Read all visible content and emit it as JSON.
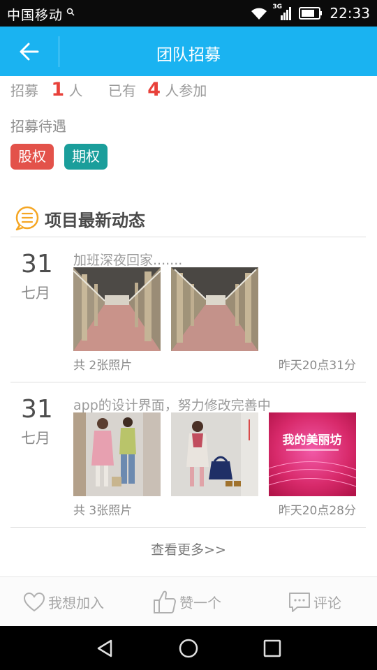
{
  "status_bar": {
    "carrier": "中国移动",
    "network": "3G",
    "time": "22:33"
  },
  "header": {
    "title": "团队招募",
    "back_icon": "arrow-left-icon"
  },
  "recruit": {
    "prefix": "招募",
    "count": "1",
    "unit": "人",
    "joined_prefix": "已有",
    "joined_count": "4",
    "joined_suffix": "人参加",
    "benefits_label": "招募待遇",
    "tags": [
      {
        "label": "股权",
        "color": "#e3524a"
      },
      {
        "label": "期权",
        "color": "#1a9e9b"
      }
    ]
  },
  "section": {
    "title": "项目最新动态",
    "icon": "list-bubble-icon"
  },
  "feed": [
    {
      "day": "31",
      "month": "七月",
      "text": "加班深夜回家.......",
      "count_label": "共  2张照片",
      "time": "昨天20点31分"
    },
    {
      "day": "31",
      "month": "七月",
      "text": "app的设计界面，努力修改完善中",
      "count_label": "共  3张照片",
      "time": "昨天20点28分",
      "banner_text": "我的美丽坊"
    }
  ],
  "see_more": "查看更多>>",
  "actions": {
    "join": "我想加入",
    "like": "赞一个",
    "comment": "评论"
  },
  "colors": {
    "accent": "#1ab3f1",
    "highlight_red": "#e8413a",
    "section_icon": "#f5a623"
  }
}
